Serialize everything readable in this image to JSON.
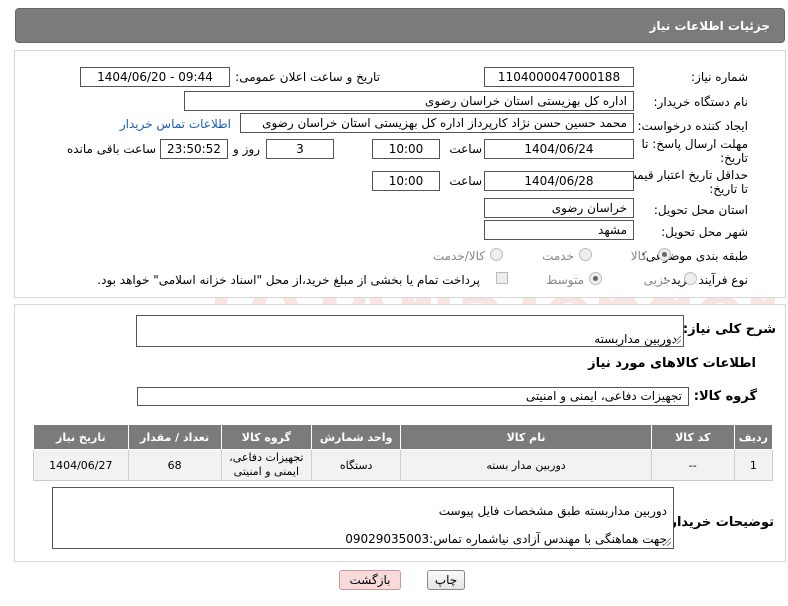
{
  "header": {
    "title": "جزئیات اطلاعات نیاز"
  },
  "form": {
    "need_number": {
      "label": "شماره نیاز:",
      "value": "1104000047000188"
    },
    "announce_datetime": {
      "label": "تاریخ و ساعت اعلان عمومی:",
      "value": "1404/06/20 - 09:44"
    },
    "buyer_org": {
      "label": "نام دستگاه خریدار:",
      "value": "اداره کل بهزیستی استان خراسان رضوی"
    },
    "requester": {
      "label": "ایجاد کننده درخواست:",
      "value": "محمد حسین حسن نژاد کارپرداز اداره کل بهزیستی استان خراسان رضوی",
      "contact_link": "اطلاعات تماس خریدار"
    },
    "reply_deadline": {
      "label_line1": "مهلت ارسال پاسخ: تا",
      "label_line2": "تاریخ:",
      "date": "1404/06/24",
      "time_label": "ساعت",
      "time": "10:00",
      "days": "3",
      "days_label": "روز و",
      "remaining": "23:50:52",
      "remaining_label": "ساعت باقی مانده"
    },
    "price_validity": {
      "label_line1": "حداقل تاریخ اعتبار قیمت:",
      "label_line2": "تا تاریخ:",
      "date": "1404/06/28",
      "time_label": "ساعت",
      "time": "10:00"
    },
    "delivery_province": {
      "label": "استان محل تحویل:",
      "value": "خراسان رضوی"
    },
    "delivery_city": {
      "label": "شهر محل تحویل:",
      "value": "مشهد"
    },
    "category": {
      "label": "طبقه بندی موضوعی:",
      "options": [
        "کالا",
        "خدمت",
        "کالا/خدمت"
      ],
      "selected": "کالا"
    },
    "process_type": {
      "label": "نوع فرآیند خرید :",
      "options": [
        "جزیی",
        "متوسط"
      ],
      "selected": "متوسط",
      "payment_note": "پرداخت تمام یا بخشی از مبلغ خرید،از محل \"اسناد خزانه اسلامی\" خواهد بود."
    }
  },
  "description": {
    "label": "شرح کلی نیاز:",
    "value": "دوربین مداربسته"
  },
  "goods_section": {
    "title": "اطلاعات کالاهای مورد نیاز"
  },
  "goods_group": {
    "label": "گروه کالا:",
    "value": "تجهیزات دفاعی، ایمنی و امنیتی"
  },
  "table": {
    "headers": [
      "ردیف",
      "کد کالا",
      "نام کالا",
      "واحد شمارش",
      "گروه کالا",
      "تعداد / مقدار",
      "تاریخ نیاز"
    ],
    "rows": [
      [
        "1",
        "--",
        "دوربین مدار بسته",
        "دستگاه",
        "تجهیزات دفاعی، ایمنی و امنیتی",
        "68",
        "1404/06/27"
      ]
    ]
  },
  "buyer_notes": {
    "label": "توضیحات خریدار:",
    "line1": "دوربین مداربسته طبق مشخصات فایل پیوست",
    "line2": "جهت هماهنگی با مهندس آزادی نیاشماره تماس:09029035003"
  },
  "buttons": {
    "print": "چاپ",
    "back": "بازگشت"
  },
  "watermark": {
    "text": "AriaTender.neT"
  },
  "colors": {
    "header_bg": "#7b7b7b",
    "link": "#1a5fb4",
    "back_button": "#f8dada"
  }
}
